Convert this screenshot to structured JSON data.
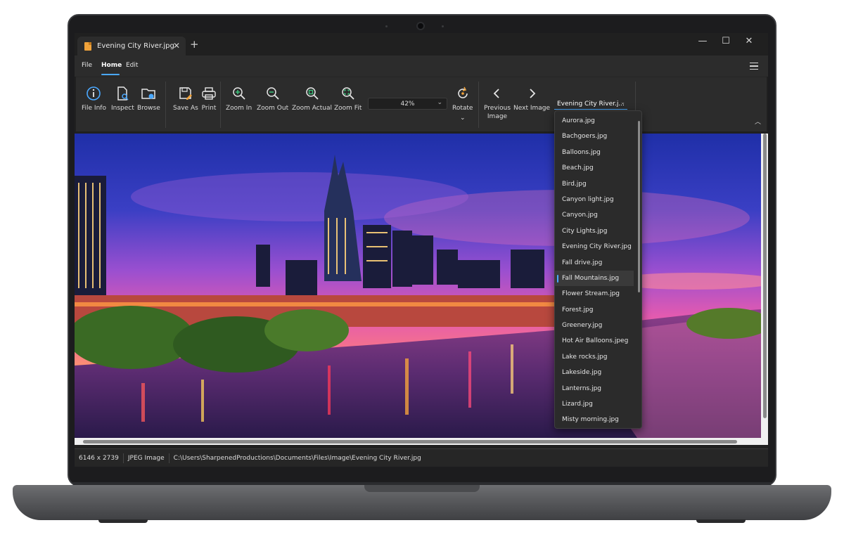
{
  "tab": {
    "title": "Evening City River.jpg",
    "close": "✕",
    "new": "+"
  },
  "window": {
    "minimize": "—",
    "maximize": "☐",
    "close": "✕"
  },
  "menu": {
    "file": "File",
    "home": "Home",
    "edit": "Edit"
  },
  "ribbon": {
    "file_info": "File Info",
    "inspect": "Inspect",
    "browse": "Browse",
    "save_as": "Save As",
    "print": "Print",
    "zoom_in": "Zoom In",
    "zoom_out": "Zoom Out",
    "zoom_actual": "Zoom Actual",
    "zoom_fit": "Zoom Fit",
    "zoom_level": "42%",
    "rotate": "Rotate",
    "previous_image": "Previous Image",
    "next_image": "Next Image",
    "selected_file": "Evening City River.j..."
  },
  "dropdown_items": [
    "Aurora.jpg",
    "Bachgoers.jpg",
    "Balloons.jpg",
    "Beach.jpg",
    "Bird.jpg",
    "Canyon light.jpg",
    "Canyon.jpg",
    "City Lights.jpg",
    "Evening City River.jpg",
    "Fall drive.jpg",
    "Fall Mountains.jpg",
    "Flower Stream.jpg",
    "Forest.jpg",
    "Greenery.jpg",
    "Hot Air Balloons.jpeg",
    "Lake rocks.jpg",
    "Lakeside.jpg",
    "Lanterns.jpg",
    "Lizard.jpg",
    "Misty morning.jpg"
  ],
  "highlighted_item": "Fall Mountains.jpg",
  "status": {
    "dimensions": "6146 x 2739",
    "type": "JPEG Image",
    "path": "C:\\Users\\SharpenedProductions\\Documents\\Files\\Image\\Evening City River.jpg"
  },
  "colors": {
    "accent": "#4aa8ff",
    "file_icon": "#f0a23a",
    "chrome": "#2c2c2c"
  }
}
